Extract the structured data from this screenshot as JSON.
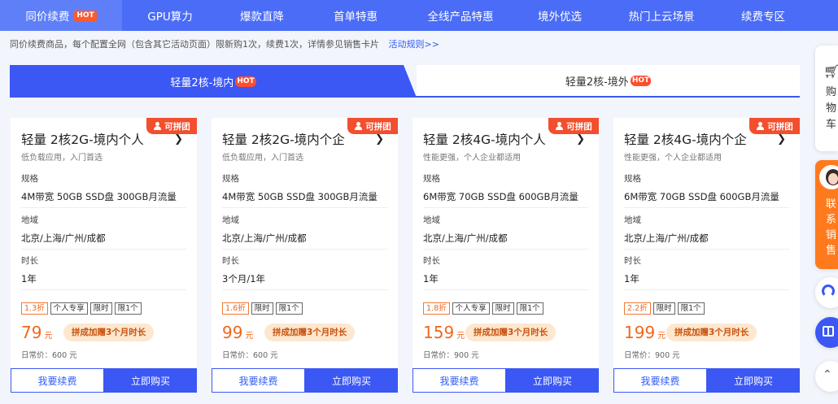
{
  "topnav": {
    "tabs": [
      {
        "label": "同价续费",
        "hot": "HOT"
      },
      {
        "label": "GPU算力"
      },
      {
        "label": "爆款直降"
      },
      {
        "label": "首单特惠"
      },
      {
        "label": "全线产品特惠"
      },
      {
        "label": "境外优选"
      },
      {
        "label": "热门上云场景"
      },
      {
        "label": "续费专区"
      }
    ]
  },
  "notice": {
    "text": "同价续费商品，每个配置全网（包含其它活动页面）限新购1次，续费1次，详情参见销售卡片",
    "link": "活动规则>>"
  },
  "subtabs": [
    {
      "label": "轻量2核-境内",
      "hot": "HOT"
    },
    {
      "label": "轻量2核-境外",
      "hot": "HOT"
    }
  ],
  "labels": {
    "spec": "规格",
    "region": "地域",
    "duration": "时长",
    "badge": "可拼团",
    "promo": "拼成加赠3个月时长",
    "renew": "我要续费",
    "buy": "立即购买",
    "currency_unit": "元"
  },
  "cards": [
    {
      "title": "轻量 2核2G-境内个人",
      "desc": "低负载应用，入门首选",
      "spec": "4M带宽 50GB SSD盘 300GB月流量",
      "region": "北京/上海/广州/成都",
      "duration": "1年",
      "discount": "1.3折",
      "tags": [
        "个人专享",
        "限时",
        "限1个"
      ],
      "price": "79",
      "daily": "日常价：600 元"
    },
    {
      "title": "轻量 2核2G-境内个企",
      "desc": "低负载应用，入门首选",
      "spec": "4M带宽 50GB SSD盘 300GB月流量",
      "region": "北京/上海/广州/成都",
      "duration": "3个月/1年",
      "discount": "1.6折",
      "tags": [
        "限时",
        "限1个"
      ],
      "price": "99",
      "daily": "日常价：600 元"
    },
    {
      "title": "轻量 2核4G-境内个人",
      "desc": "性能更强，个人企业都适用",
      "spec": "6M带宽 70GB SSD盘 600GB月流量",
      "region": "北京/上海/广州/成都",
      "duration": "1年",
      "discount": "1.8折",
      "tags": [
        "个人专享",
        "限时",
        "限1个"
      ],
      "price": "159",
      "daily": "日常价：900 元"
    },
    {
      "title": "轻量 2核4G-境内个企",
      "desc": "性能更强，个人企业都适用",
      "spec": "6M带宽 70GB SSD盘 600GB月流量",
      "region": "北京/上海/广州/成都",
      "duration": "1年",
      "discount": "2.2折",
      "tags": [
        "限时",
        "限1个"
      ],
      "price": "199",
      "daily": "日常价：900 元"
    }
  ],
  "sidebar": {
    "cart": "购物车",
    "contact": "联系销售",
    "icons": [
      "cart-icon",
      "support-icon",
      "gift-icon",
      "back-to-top-icon"
    ]
  },
  "colors": {
    "primary": "#3b57f4",
    "nav": "#4a6cf7",
    "accent": "#f0671e",
    "hot": "#ff5a2d"
  }
}
